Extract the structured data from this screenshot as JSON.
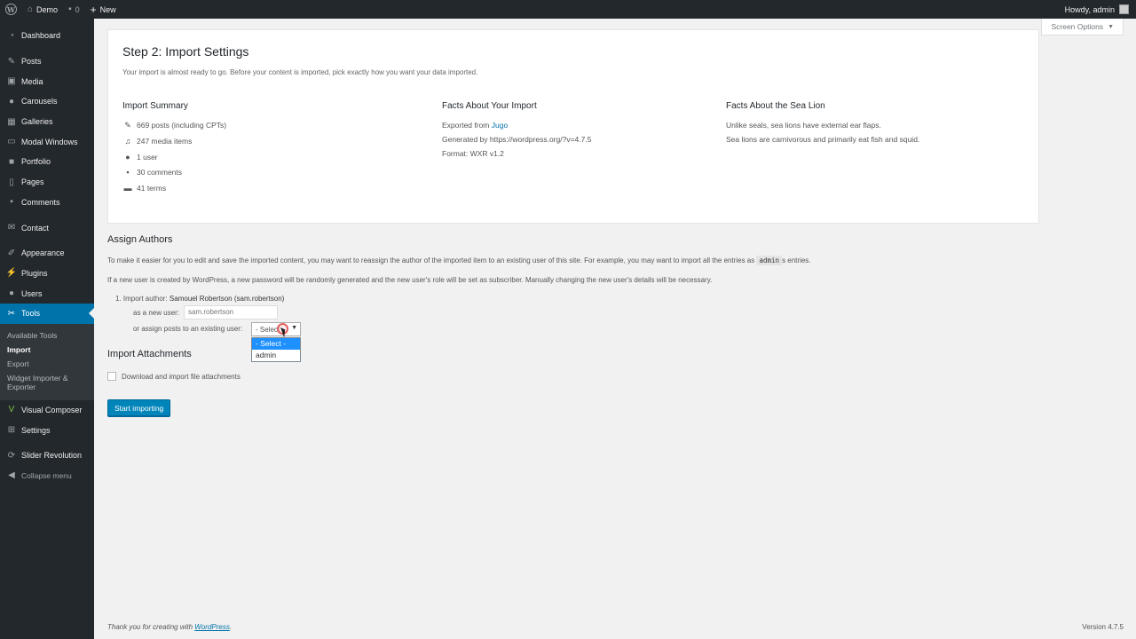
{
  "adminbar": {
    "site_name": "Demo",
    "comments_count": "0",
    "new_label": "New",
    "howdy": "Howdy, admin"
  },
  "screen_options": {
    "label": "Screen Options"
  },
  "sidebar": {
    "items": [
      {
        "label": "Dashboard",
        "icon": "dashboard-icon"
      },
      {
        "label": "Posts",
        "icon": "pin-icon"
      },
      {
        "label": "Media",
        "icon": "media-icon"
      },
      {
        "label": "Carousels",
        "icon": "carousel-icon"
      },
      {
        "label": "Galleries",
        "icon": "gallery-icon"
      },
      {
        "label": "Modal Windows",
        "icon": "window-icon"
      },
      {
        "label": "Portfolio",
        "icon": "portfolio-icon"
      },
      {
        "label": "Pages",
        "icon": "page-icon"
      },
      {
        "label": "Comments",
        "icon": "comment-icon"
      },
      {
        "label": "Contact",
        "icon": "mail-icon"
      },
      {
        "label": "Appearance",
        "icon": "brush-icon"
      },
      {
        "label": "Plugins",
        "icon": "plugin-icon"
      },
      {
        "label": "Users",
        "icon": "user-icon"
      },
      {
        "label": "Tools",
        "icon": "wrench-icon"
      },
      {
        "label": "Visual Composer",
        "icon": "vc-icon"
      },
      {
        "label": "Settings",
        "icon": "settings-icon"
      },
      {
        "label": "Slider Revolution",
        "icon": "slider-icon"
      },
      {
        "label": "Collapse menu",
        "icon": "collapse-icon"
      }
    ],
    "tools_sub": [
      {
        "label": "Available Tools"
      },
      {
        "label": "Import"
      },
      {
        "label": "Export"
      },
      {
        "label": "Widget Importer & Exporter"
      }
    ]
  },
  "main": {
    "title": "Step 2: Import Settings",
    "intro": "Your import is almost ready to go. Before your content is imported, pick exactly how you want your data imported.",
    "summary": {
      "heading": "Import Summary",
      "lines": [
        "669 posts (including CPTs)",
        "247 media items",
        "1 user",
        "30 comments",
        "41 terms"
      ]
    },
    "facts": {
      "heading": "Facts About Your Import",
      "exported_prefix": "Exported from ",
      "exported_link": "Jugo",
      "generated": "Generated by https://wordpress.org/?v=4.7.5",
      "format": "Format: WXR v1.2"
    },
    "sealion": {
      "heading": "Facts About the Sea Lion",
      "lines": [
        "Unlike seals, sea lions have external ear flaps.",
        "Sea lions are carnivorous and primarily eat fish and squid."
      ]
    },
    "assign": {
      "heading": "Assign Authors",
      "para1_a": "To make it easier for you to edit and save the imported content, you may want to reassign the author of the imported item to an existing user of this site. For example, you may want to import all the entries as ",
      "para1_code": "admin",
      "para1_b": "s entries.",
      "para2": "If a new user is created by WordPress, a new password will be randomly generated and the new user's role will be set as subscriber. Manually changing the new user's details will be necessary.",
      "author_prefix": "1. Import author: ",
      "author_name": "Samouel Robertson (sam.robertson)",
      "new_user_label": "as a new user:",
      "new_user_value": "sam.robertson",
      "existing_label": "or assign posts to an existing user:",
      "select_value": "- Select -",
      "options": [
        "- Select -",
        "admin"
      ]
    },
    "attachments": {
      "heading": "Import Attachments",
      "checkbox_label": "Download and import file attachments"
    },
    "submit": "Start importing"
  },
  "footer": {
    "thanks_prefix": "Thank you for creating with ",
    "thanks_link": "WordPress",
    "thanks_suffix": ".",
    "version": "Version 4.7.5"
  }
}
